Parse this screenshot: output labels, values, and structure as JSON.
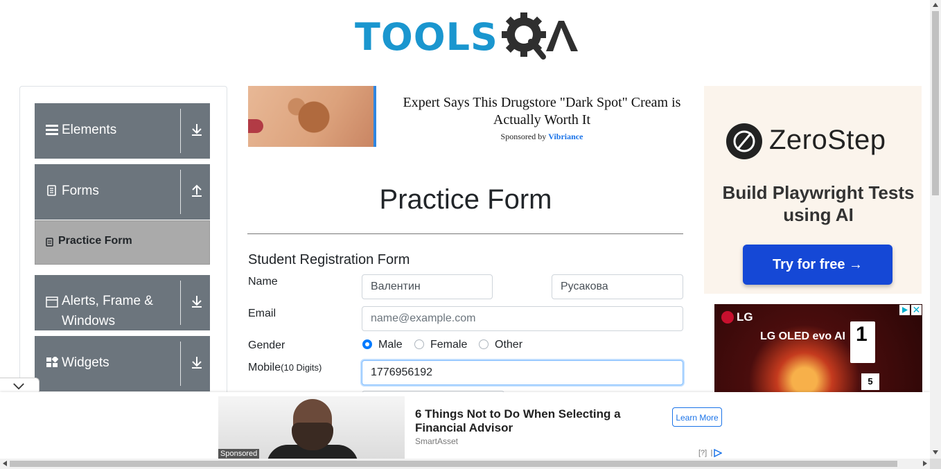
{
  "header": {
    "logo_text": "TOOLS",
    "logo_suffix": "A"
  },
  "sidebar": {
    "groups": [
      {
        "label": "Elements",
        "icon": "hamburger-icon",
        "arrow": "download-icon"
      },
      {
        "label": "Forms",
        "icon": "document-icon",
        "arrow": "upload-icon"
      },
      {
        "label": "Alerts, Frame & Windows",
        "icon": "window-icon",
        "arrow": "download-icon"
      },
      {
        "label": "Widgets",
        "icon": "widgets-icon",
        "arrow": "download-icon"
      }
    ],
    "active_item": {
      "label": "Practice Form",
      "icon": "clipboard-icon"
    }
  },
  "top_ad": {
    "headline": "Expert Says This Drugstore \"Dark Spot\" Cream is Actually Worth It",
    "sponsored_prefix": "Sponsored by",
    "sponsor": "Vibriance"
  },
  "form": {
    "title": "Practice Form",
    "subtitle": "Student Registration Form",
    "name_label": "Name",
    "first_name": "Валентин",
    "last_name": "Русакова",
    "email_label": "Email",
    "email_placeholder": "name@example.com",
    "gender_label": "Gender",
    "gender_options": [
      "Male",
      "Female",
      "Other"
    ],
    "gender_selected": "Male",
    "mobile_label": "Mobile",
    "mobile_hint": "(10 Digits)",
    "mobile_value": "1776956192"
  },
  "right_ad": {
    "brand": "ZeroStep",
    "tagline": "Build Playwright Tests using AI",
    "cta": "Try for free →"
  },
  "lg_ad": {
    "brand": "LG",
    "product": "LG OLED evo AI",
    "rank": "1",
    "tv_label": "5"
  },
  "bottom_ad": {
    "headline": "6 Things Not to Do When Selecting a Financial Advisor",
    "source": "SmartAsset",
    "cta": "Learn More",
    "sponsored": "Sponsored",
    "info": "[?]"
  },
  "colors": {
    "sidebar_group": "#6c757d",
    "logo_blue": "#1a96cf",
    "accent": "#007bff"
  }
}
